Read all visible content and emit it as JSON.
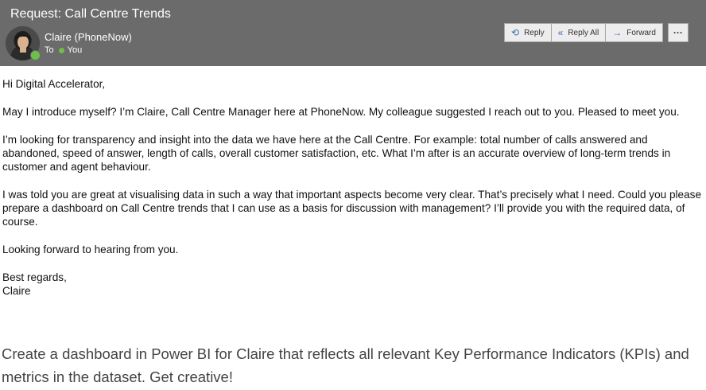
{
  "email": {
    "subject": "Request: Call Centre Trends",
    "sender": "Claire (PhoneNow)",
    "to_label": "To",
    "to_recipient": "You",
    "avatar_icon": "person-photo-avatar",
    "presence_color": "#6cc04a"
  },
  "actions": {
    "reply": {
      "label": "Reply",
      "icon": "reply-arrow-icon"
    },
    "reply_all": {
      "label": "Reply All",
      "icon": "reply-all-arrow-icon"
    },
    "forward": {
      "label": "Forward",
      "icon": "forward-arrow-icon"
    },
    "more": {
      "label": "···",
      "icon": "more-dots-icon"
    }
  },
  "body": {
    "greeting": "Hi Digital Accelerator,",
    "p1": "May I introduce myself? I’m Claire, Call Centre Manager here at PhoneNow. My colleague suggested I reach out to you. Pleased to meet you.",
    "p2": "I’m looking for transparency and insight into the data we have here at the Call Centre. For example: total number of calls answered and abandoned, speed of answer, length of calls, overall customer satisfaction, etc. What I’m after is an accurate overview of long-term trends in customer and agent behaviour.",
    "p3": "I was told you are great at visualising data in such a way that important aspects become very clear. That’s precisely what I need. Could you please prepare a dashboard on Call Centre trends that I can use as a basis for discussion with management? I’ll provide you with the required data, of course.",
    "closing_line": "Looking forward to hearing from you.",
    "signoff": "Best regards,",
    "signature": "Claire"
  },
  "task": {
    "text": "Create a dashboard in Power BI for Claire that reflects all relevant Key Performance Indicators (KPIs) and metrics in the dataset. Get creative!"
  }
}
